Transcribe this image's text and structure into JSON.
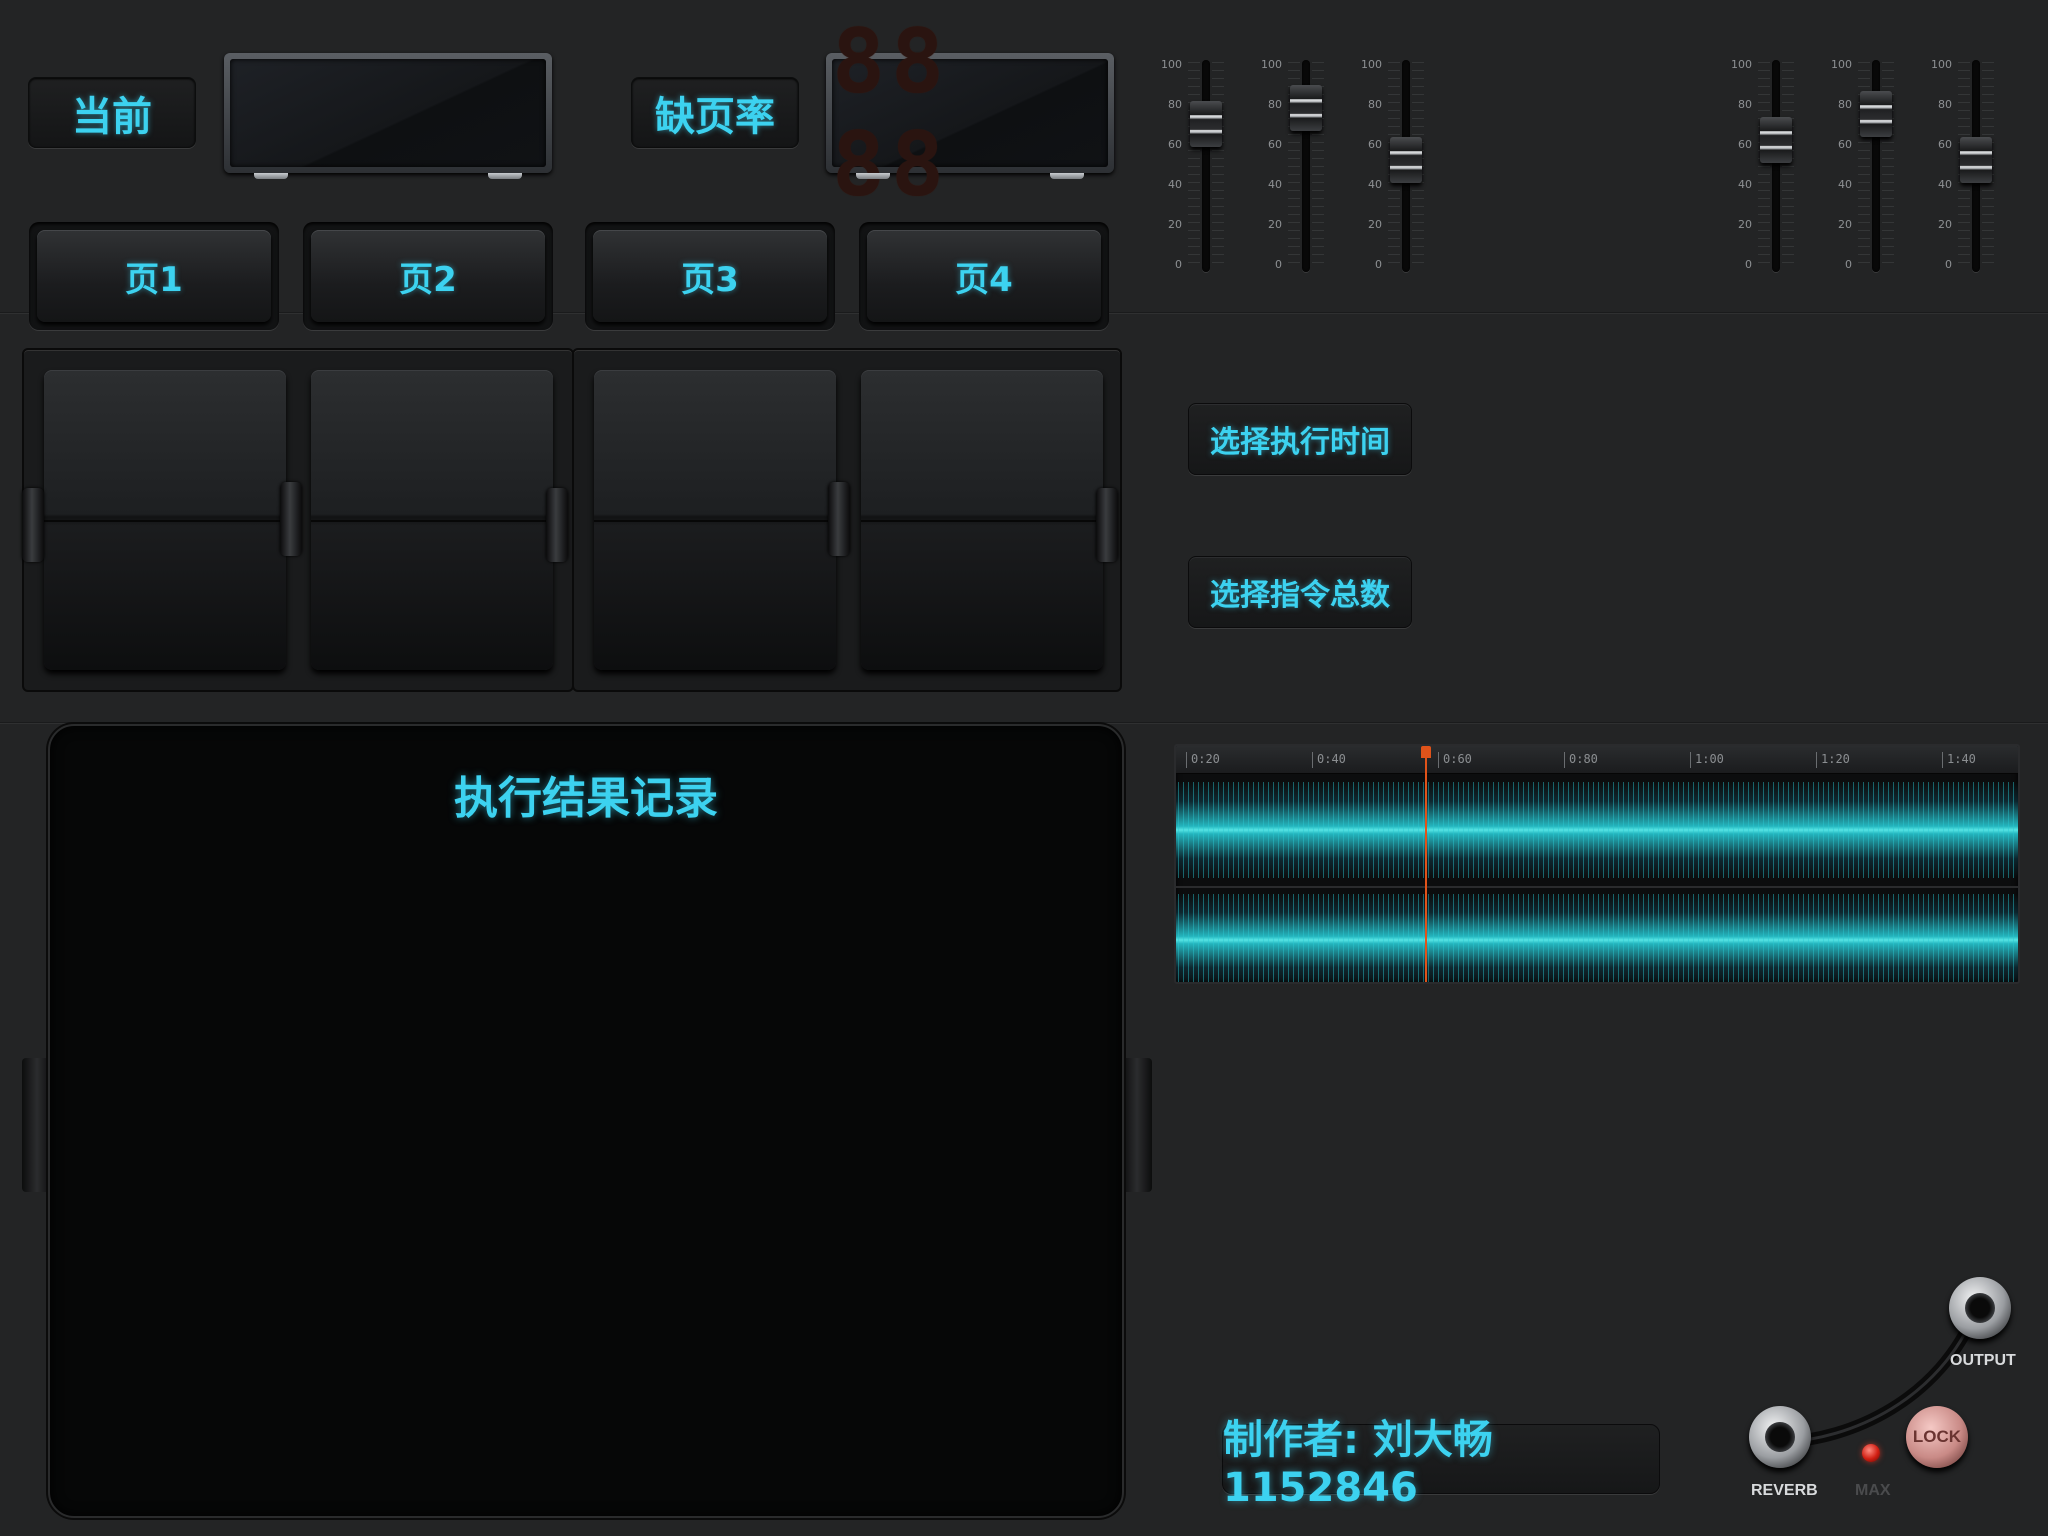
{
  "header": {
    "current_label": "当前",
    "fault_rate_label": "缺页率",
    "fault_rate_display": "88 88"
  },
  "pages": [
    {
      "label": "页1"
    },
    {
      "label": "页2"
    },
    {
      "label": "页3"
    },
    {
      "label": "页4"
    }
  ],
  "faders": {
    "scale": [
      "100",
      "80",
      "60",
      "40",
      "20",
      "0"
    ],
    "left_group": [
      {
        "level": 70
      },
      {
        "level": 78
      },
      {
        "level": 52
      }
    ],
    "right_group": [
      {
        "level": 62
      },
      {
        "level": 75
      },
      {
        "level": 52
      }
    ]
  },
  "actions": {
    "select_time": "选择执行时间",
    "select_total": "选择指令总数"
  },
  "record": {
    "title": "执行结果记录"
  },
  "waveform": {
    "ruler": [
      "0:20",
      "0:40",
      "0:60",
      "0:80",
      "1:00",
      "1:20",
      "1:40"
    ],
    "accent": "#e0531a",
    "wave_color": "#3cd2e0"
  },
  "author": {
    "text": "制作者: 刘大畅 1152846"
  },
  "controls": {
    "output_label": "OUTPUT",
    "reverb_label": "REVERB",
    "max_label": "MAX",
    "lock_label": "LOCK"
  }
}
